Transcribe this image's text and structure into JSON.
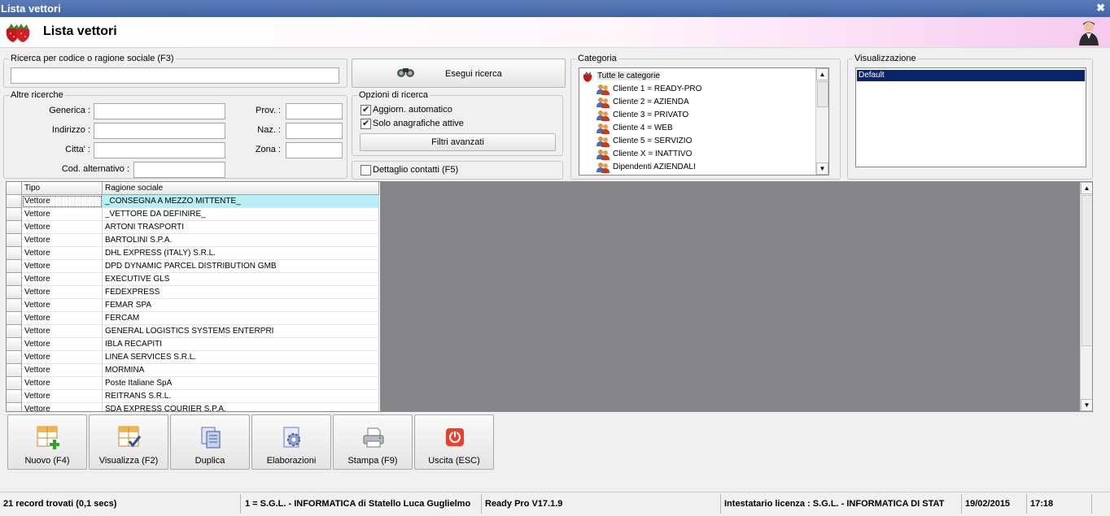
{
  "window": {
    "title": "Lista vettori"
  },
  "header": {
    "title": "Lista vettori"
  },
  "search": {
    "legend": "Ricerca per codice o ragione sociale (F3)",
    "value": "",
    "exec_label": "Esegui ricerca"
  },
  "other": {
    "legend": "Altre ricerche",
    "generica_label": "Generica :",
    "indirizzo_label": "Indirizzo :",
    "citta_label": "Citta' :",
    "cod_alt_label": "Cod. alternativo :",
    "prov_label": "Prov. :",
    "naz_label": "Naz. :",
    "zona_label": "Zona :"
  },
  "options": {
    "legend": "Opzioni di ricerca",
    "auto_label": "Aggiorn. automatico",
    "auto_checked": true,
    "active_label": "Solo anagrafiche attive",
    "active_checked": true,
    "filters_label": "Filtri avanzati",
    "contacts_label": "Dettaglio contatti (F5)",
    "contacts_checked": false
  },
  "category": {
    "legend": "Categoria",
    "items": [
      "Tutte le categorie",
      "Cliente 1 = READY-PRO",
      "Cliente 2 = AZIENDA",
      "Cliente 3 = PRIVATO",
      "Cliente 4 = WEB",
      "Cliente 5 = SERVIZIO",
      "Cliente X = INATTIVO",
      "Dipendenti AZIENDALI"
    ]
  },
  "view": {
    "legend": "Visualizzazione",
    "items": [
      "Default"
    ]
  },
  "grid": {
    "columns": [
      "Tipo",
      "Ragione sociale"
    ],
    "rows": [
      [
        "Vettore",
        "_CONSEGNA A MEZZO MITTENTE_"
      ],
      [
        "Vettore",
        "_VETTORE DA DEFINIRE_"
      ],
      [
        "Vettore",
        "ARTONI TRASPORTI"
      ],
      [
        "Vettore",
        "BARTOLINI S.P.A."
      ],
      [
        "Vettore",
        "DHL EXPRESS (ITALY) S.R.L."
      ],
      [
        "Vettore",
        "DPD DYNAMIC PARCEL DISTRIBUTION GMB"
      ],
      [
        "Vettore",
        "EXECUTIVE GLS"
      ],
      [
        "Vettore",
        "FEDEXPRESS"
      ],
      [
        "Vettore",
        "FEMAR SPA"
      ],
      [
        "Vettore",
        "FERCAM"
      ],
      [
        "Vettore",
        "GENERAL LOGISTICS SYSTEMS ENTERPRI"
      ],
      [
        "Vettore",
        "IBLA RECAPITI"
      ],
      [
        "Vettore",
        "LINEA SERVICES S.R.L."
      ],
      [
        "Vettore",
        "MORMINA"
      ],
      [
        "Vettore",
        "Poste Italiane SpA"
      ],
      [
        "Vettore",
        "REITRANS S.R.L."
      ],
      [
        "Vettore",
        "SDA EXPRESS COURIER S.P.A."
      ]
    ]
  },
  "toolbar": {
    "new_label": "Nuovo (F4)",
    "view_label": "Visualizza (F2)",
    "dup_label": "Duplica",
    "proc_label": "Elaborazioni",
    "print_label": "Stampa (F9)",
    "exit_label": "Uscita (ESC)"
  },
  "status": {
    "records": "21 record trovati (0,1 secs)",
    "company": "1 = S.G.L. - INFORMATICA di Statello Luca Guglielmo",
    "version": "Ready Pro V17.1.9",
    "license": "Intestatario licenza : S.G.L. - INFORMATICA DI STAT",
    "date": "19/02/2015",
    "time": "17:18"
  },
  "colors": {
    "title_bar": "#4a6eb0",
    "selected_row": "#b8eef5",
    "selected_item": "#0a246a",
    "grid_bg": "#858489"
  }
}
